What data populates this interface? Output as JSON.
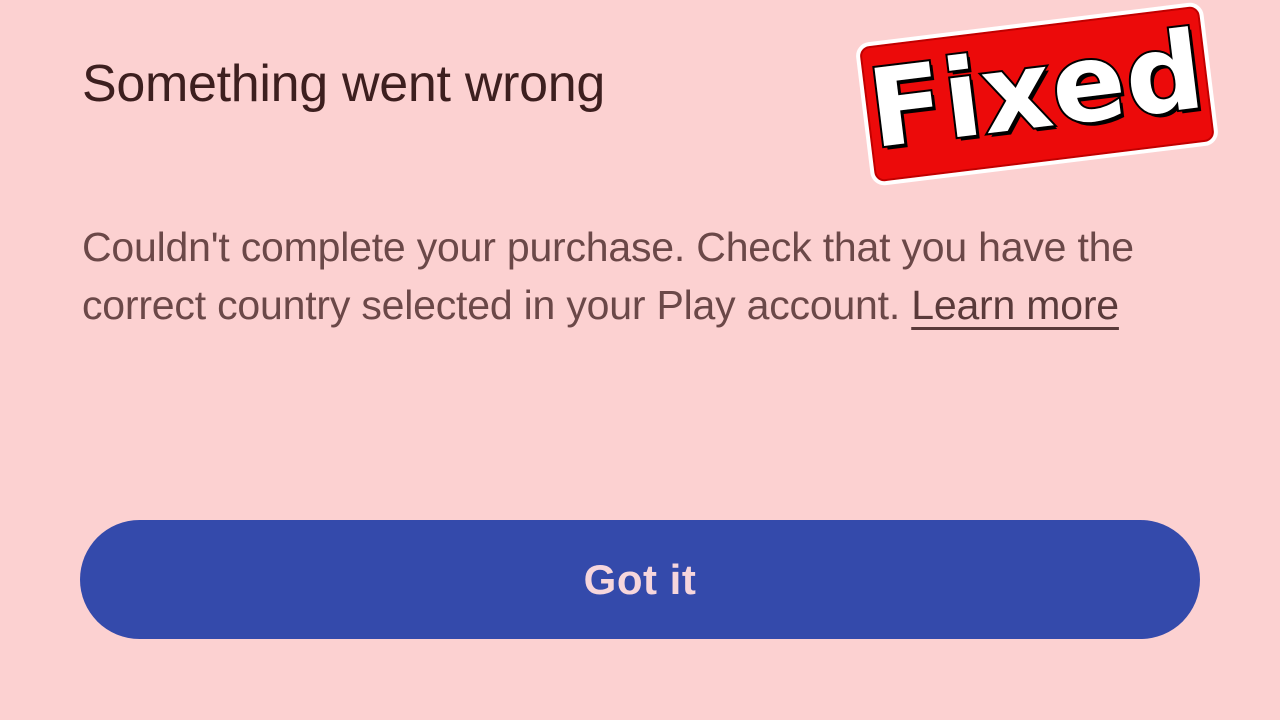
{
  "dialog": {
    "title": "Something went wrong",
    "message": "Couldn't complete your purchase. Check that you have the correct country selected in your Play account.",
    "learn_more_label": "Learn more",
    "primary_button_label": "Got it"
  },
  "overlay": {
    "stamp_text": "Fixed"
  },
  "colors": {
    "background": "#fcd1d1",
    "title": "#3d1f1f",
    "body_text": "#6b4848",
    "button_background": "#344aab",
    "button_text": "#f6d6dc",
    "stamp_background": "#ec0a0a"
  }
}
